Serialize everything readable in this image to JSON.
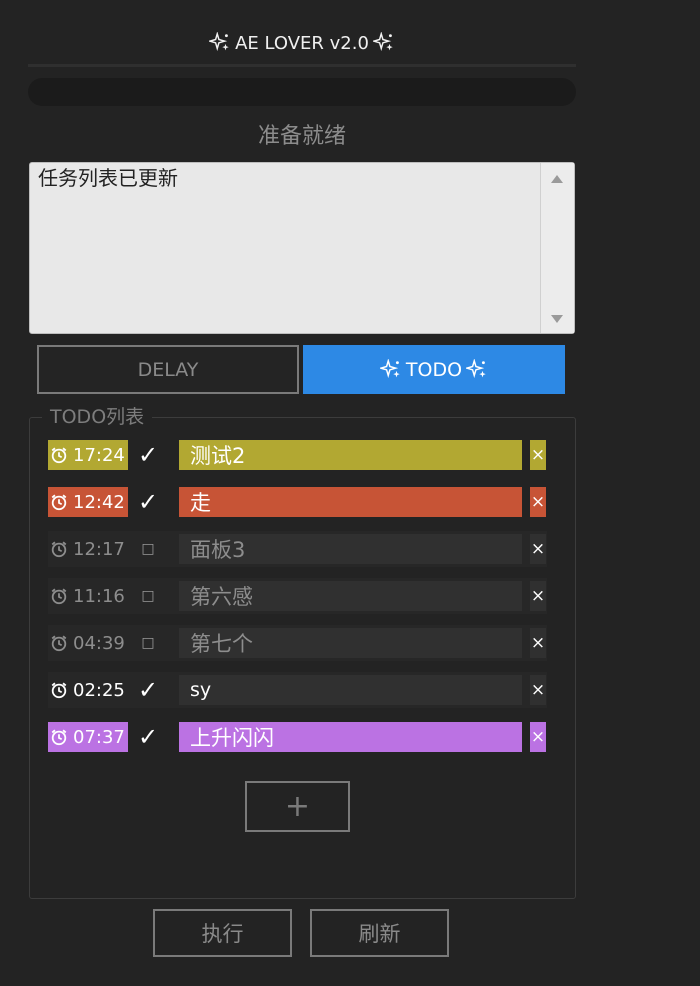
{
  "app": {
    "title": "AE LOVER v2.0",
    "title_icon": "sparkle-icon"
  },
  "progress": {
    "value": 0
  },
  "status_text": "准备就绪",
  "log": {
    "text": "任务列表已更新"
  },
  "modes": {
    "delay_label": "DELAY",
    "todo_label": "TODO",
    "active": "TODO",
    "active_color": "#2d89e5"
  },
  "todo_list": {
    "legend": "TODO列表",
    "items": [
      {
        "time": "17:24",
        "check": "✓",
        "label": "测试2",
        "done": true,
        "color": "#b2a832"
      },
      {
        "time": "12:42",
        "check": "✓",
        "label": "走",
        "done": true,
        "color": "#c75436"
      },
      {
        "time": "12:17",
        "check": "□",
        "label": "面板3",
        "done": false,
        "color": ""
      },
      {
        "time": "11:16",
        "check": "□",
        "label": "第六感",
        "done": false,
        "color": ""
      },
      {
        "time": "04:39",
        "check": "□",
        "label": "第七个",
        "done": false,
        "color": ""
      },
      {
        "time": "02:25",
        "check": "✓",
        "label": "sy",
        "done": true,
        "color": "#303030"
      },
      {
        "time": "07:37",
        "check": "✓",
        "label": "上升闪闪",
        "done": true,
        "color": "#bb72e3"
      }
    ],
    "delete_symbol": "×",
    "add_label": "+"
  },
  "buttons": {
    "run_label": "执行",
    "refresh_label": "刷新"
  }
}
